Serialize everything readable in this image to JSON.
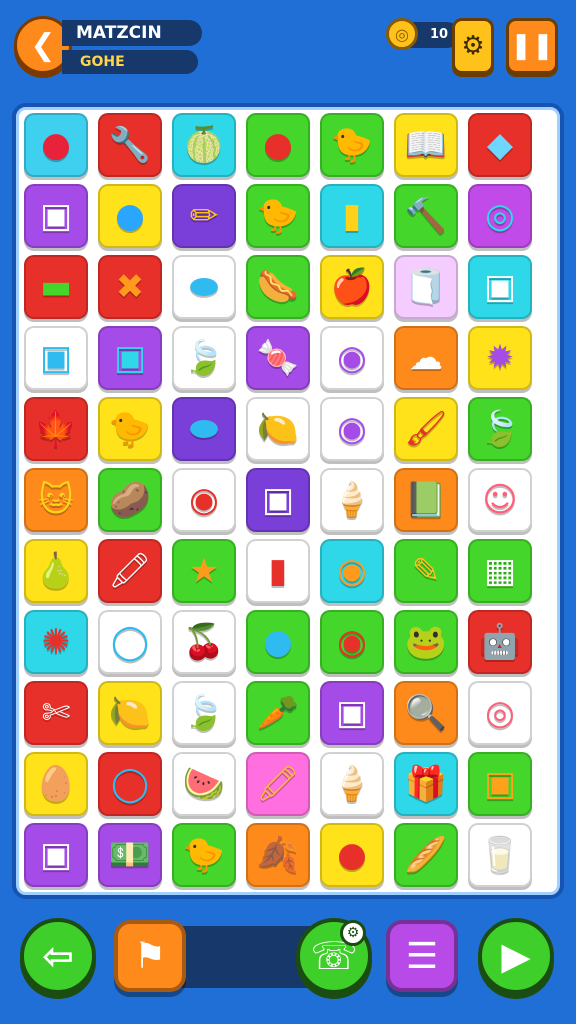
{
  "header": {
    "back_icon": "back-arrow-icon",
    "title": "MATZCIN",
    "subtitle": "GOHE",
    "coin_count": "10",
    "settings_icon": "gear-icon",
    "pause_icon": "pause-icon"
  },
  "board": {
    "tiles": [
      {
        "glyph": "●",
        "bg": "#3fd0ef",
        "fg": "#e8223a",
        "name": "red-ball-tile"
      },
      {
        "glyph": "🔧",
        "bg": "#e8302a",
        "fg": "#ffffff",
        "name": "wrench-tile"
      },
      {
        "glyph": "🍈",
        "bg": "#2fd8e8",
        "fg": "#46b82a",
        "name": "melon-tile"
      },
      {
        "glyph": "●",
        "bg": "#44d62a",
        "fg": "#e8302a",
        "name": "red-ball-tile"
      },
      {
        "glyph": "🐤",
        "bg": "#44d62a",
        "fg": "#ff9a1c",
        "name": "chick-tile"
      },
      {
        "glyph": "📖",
        "bg": "#ffe21a",
        "fg": "#ffffff",
        "name": "open-book-tile"
      },
      {
        "glyph": "◆",
        "bg": "#e8302a",
        "fg": "#6fd6ff",
        "name": "crystal-tile"
      },
      {
        "glyph": "▣",
        "bg": "#a54be8",
        "fg": "#ffffff",
        "name": "dice-box-tile"
      },
      {
        "glyph": "●",
        "bg": "#ffe21a",
        "fg": "#2aa6ff",
        "name": "blue-bulb-tile"
      },
      {
        "glyph": "✏",
        "bg": "#7a3fd8",
        "fg": "#ffc21a",
        "name": "pencil-tile"
      },
      {
        "glyph": "🐤",
        "bg": "#44d62a",
        "fg": "#ff9a1c",
        "name": "bird-tile"
      },
      {
        "glyph": "▮",
        "bg": "#2fd8e8",
        "fg": "#ffd21a",
        "name": "crayon-tile"
      },
      {
        "glyph": "🔨",
        "bg": "#44d62a",
        "fg": "#ff9a1c",
        "name": "mallet-tile"
      },
      {
        "glyph": "◎",
        "bg": "#c04be8",
        "fg": "#2fd8e8",
        "name": "ring-tile"
      },
      {
        "glyph": "▬",
        "bg": "#e8302a",
        "fg": "#44d62a",
        "name": "green-bar-tile"
      },
      {
        "glyph": "✖",
        "bg": "#e8302a",
        "fg": "#ff9a1c",
        "name": "x-box-tile"
      },
      {
        "glyph": "⬬",
        "bg": "#ffffff",
        "fg": "#2fbaf0",
        "name": "blue-capsule-tile"
      },
      {
        "glyph": "🌭",
        "bg": "#44d62a",
        "fg": "#e8302a",
        "name": "sausage-tile"
      },
      {
        "glyph": "🍎",
        "bg": "#ffe21a",
        "fg": "#e8302a",
        "name": "apple-tile"
      },
      {
        "glyph": "🧻",
        "bg": "#f4ccff",
        "fg": "#2fd8e8",
        "name": "roll-tile"
      },
      {
        "glyph": "▣",
        "bg": "#2fd8e8",
        "fg": "#ffffff",
        "name": "cube-box-tile"
      },
      {
        "glyph": "▣",
        "bg": "#ffffff",
        "fg": "#2fbaf0",
        "name": "ice-cube-tile"
      },
      {
        "glyph": "▣",
        "bg": "#a54be8",
        "fg": "#2fd8e8",
        "name": "cyan-cube-tile"
      },
      {
        "glyph": "🍃",
        "bg": "#ffffff",
        "fg": "#46b82a",
        "name": "leaf-tile"
      },
      {
        "glyph": "🍬",
        "bg": "#a54be8",
        "fg": "#ff6f8a",
        "name": "candy-tile"
      },
      {
        "glyph": "◉",
        "bg": "#ffffff",
        "fg": "#a54be8",
        "name": "donut-tile"
      },
      {
        "glyph": "☁",
        "bg": "#ff8a1c",
        "fg": "#ffffff",
        "name": "cloud-bone-tile"
      },
      {
        "glyph": "✹",
        "bg": "#ffe21a",
        "fg": "#a54be8",
        "name": "purple-blob-tile"
      },
      {
        "glyph": "🍁",
        "bg": "#e8302a",
        "fg": "#46b82a",
        "name": "maple-leaf-tile"
      },
      {
        "glyph": "🐤",
        "bg": "#ffe21a",
        "fg": "#ff9a1c",
        "name": "duck-tile"
      },
      {
        "glyph": "⬬",
        "bg": "#7a3fd8",
        "fg": "#2fbaf0",
        "name": "blue-egg-tile"
      },
      {
        "glyph": "🍋",
        "bg": "#ffffff",
        "fg": "#ffa21a",
        "name": "lemon-tile"
      },
      {
        "glyph": "◉",
        "bg": "#ffffff",
        "fg": "#a54be8",
        "name": "purple-donut-tile"
      },
      {
        "glyph": "🖌",
        "bg": "#ffe21a",
        "fg": "#e8302a",
        "name": "brushes-tile"
      },
      {
        "glyph": "🍃",
        "bg": "#44d62a",
        "fg": "#46b82a",
        "name": "green-leaf-tile"
      },
      {
        "glyph": "🐱",
        "bg": "#ff8a1c",
        "fg": "#ffd21a",
        "name": "cat-face-tile"
      },
      {
        "glyph": "🥔",
        "bg": "#44d62a",
        "fg": "#ffc21a",
        "name": "potato-tile"
      },
      {
        "glyph": "◉",
        "bg": "#ffffff",
        "fg": "#e8302a",
        "name": "red-ring-tile"
      },
      {
        "glyph": "▣",
        "bg": "#7a3fd8",
        "fg": "#ffffff",
        "name": "box-tile"
      },
      {
        "glyph": "🍦",
        "bg": "#ffffff",
        "fg": "#ff9a1c",
        "name": "cone-tile"
      },
      {
        "glyph": "📗",
        "bg": "#ff8a1c",
        "fg": "#46b82a",
        "name": "green-book-tile"
      },
      {
        "glyph": "☺",
        "bg": "#ffffff",
        "fg": "#ff5f7a",
        "name": "pink-face-tile"
      },
      {
        "glyph": "🍐",
        "bg": "#ffe21a",
        "fg": "#44d62a",
        "name": "pear-tile"
      },
      {
        "glyph": "🖍",
        "bg": "#e8302a",
        "fg": "#ffffff",
        "name": "red-crayon-tile"
      },
      {
        "glyph": "★",
        "bg": "#44d62a",
        "fg": "#ff9a1c",
        "name": "orange-star-tile"
      },
      {
        "glyph": "▮",
        "bg": "#ffffff",
        "fg": "#e8302a",
        "name": "phone-tile"
      },
      {
        "glyph": "◉",
        "bg": "#2fd8e8",
        "fg": "#ff9a1c",
        "name": "orange-ring-tile"
      },
      {
        "glyph": "✎",
        "bg": "#44d62a",
        "fg": "#ffc21a",
        "name": "marker-tile"
      },
      {
        "glyph": "▦",
        "bg": "#44d62a",
        "fg": "#ffffff",
        "name": "grid-bar-tile"
      },
      {
        "glyph": "✺",
        "bg": "#2fd8e8",
        "fg": "#e8302a",
        "name": "gear-flower-tile"
      },
      {
        "glyph": "◯",
        "bg": "#ffffff",
        "fg": "#2fbaf0",
        "name": "blue-ring-tile"
      },
      {
        "glyph": "🍒",
        "bg": "#ffffff",
        "fg": "#e8302a",
        "name": "cherry-tile"
      },
      {
        "glyph": "●",
        "bg": "#44d62a",
        "fg": "#2fbaf0",
        "name": "blue-pin-tile"
      },
      {
        "glyph": "◉",
        "bg": "#44d62a",
        "fg": "#e8302a",
        "name": "target-tile"
      },
      {
        "glyph": "🐸",
        "bg": "#44d62a",
        "fg": "#46b82a",
        "name": "frog-tile"
      },
      {
        "glyph": "🤖",
        "bg": "#e8302a",
        "fg": "#ffd21a",
        "name": "robot-tile"
      },
      {
        "glyph": "✄",
        "bg": "#e8302a",
        "fg": "#ffffff",
        "name": "tool-tile"
      },
      {
        "glyph": "🍋",
        "bg": "#ffe21a",
        "fg": "#ffa21a",
        "name": "yellow-fruit-tile"
      },
      {
        "glyph": "🍃",
        "bg": "#ffffff",
        "fg": "#46b82a",
        "name": "small-leaf-tile"
      },
      {
        "glyph": "🥕",
        "bg": "#44d62a",
        "fg": "#ffc21a",
        "name": "carrot-tile"
      },
      {
        "glyph": "▣",
        "bg": "#a54be8",
        "fg": "#ffffff",
        "name": "purple-box-tile"
      },
      {
        "glyph": "🔍",
        "bg": "#ff8a1c",
        "fg": "#2fbaf0",
        "name": "magnifier-tile"
      },
      {
        "glyph": "◎",
        "bg": "#ffffff",
        "fg": "#ff5f7a",
        "name": "swirl-tile"
      },
      {
        "glyph": "🥚",
        "bg": "#ffe21a",
        "fg": "#a54be8",
        "name": "striped-egg-tile"
      },
      {
        "glyph": "◯",
        "bg": "#e8302a",
        "fg": "#2fbaf0",
        "name": "blue-loop-tile"
      },
      {
        "glyph": "🍉",
        "bg": "#ffffff",
        "fg": "#46b82a",
        "name": "watermelon-tile"
      },
      {
        "glyph": "🖍",
        "bg": "#ff6fe0",
        "fg": "#ffc21a",
        "name": "pink-crayon-tile"
      },
      {
        "glyph": "🍦",
        "bg": "#ffffff",
        "fg": "#ffc21a",
        "name": "ice-cream-tile"
      },
      {
        "glyph": "🎁",
        "bg": "#2fd8e8",
        "fg": "#ffffff",
        "name": "gift-tile"
      },
      {
        "glyph": "▣",
        "bg": "#44d62a",
        "fg": "#ffa21a",
        "name": "crate-tile"
      },
      {
        "glyph": "▣",
        "bg": "#a54be8",
        "fg": "#ffffff",
        "name": "white-box-tile"
      },
      {
        "glyph": "💵",
        "bg": "#a54be8",
        "fg": "#44d62a",
        "name": "cash-tile"
      },
      {
        "glyph": "🐤",
        "bg": "#44d62a",
        "fg": "#ffd21a",
        "name": "yellow-chick-tile"
      },
      {
        "glyph": "🍂",
        "bg": "#ff8a1c",
        "fg": "#ffd21a",
        "name": "orange-leaf-tile"
      },
      {
        "glyph": "●",
        "bg": "#ffe21a",
        "fg": "#e8302a",
        "name": "tomato-tile"
      },
      {
        "glyph": "🥖",
        "bg": "#44d62a",
        "fg": "#ffc21a",
        "name": "bread-tile"
      },
      {
        "glyph": "🥛",
        "bg": "#ffffff",
        "fg": "#ff6fa8",
        "name": "milk-box-tile"
      }
    ]
  },
  "footer": {
    "back_icon": "left-arrow-icon",
    "bookmark_icon": "bookmark-icon",
    "phone_icon": "phone-icon",
    "settings_badge_icon": "gear-badge-icon",
    "menu_icon": "menu-icon",
    "play_icon": "play-icon"
  },
  "colors": {
    "background": "#1f6fd6",
    "accent_orange": "#ff8a1c",
    "accent_green": "#3fcf2a",
    "accent_purple": "#b84be8"
  }
}
